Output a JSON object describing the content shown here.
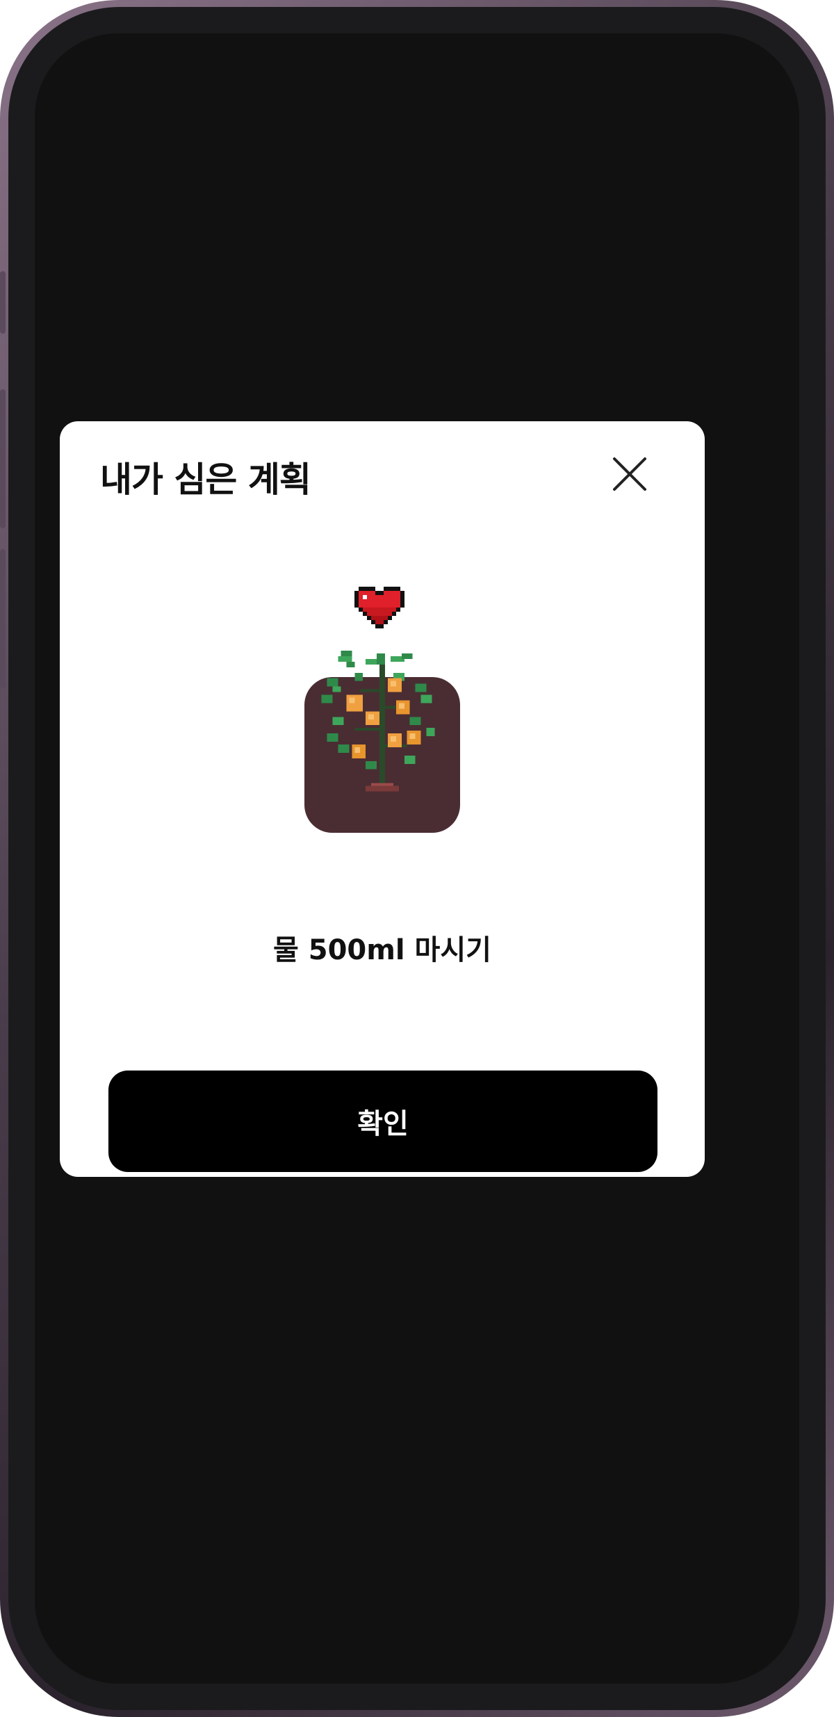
{
  "modal": {
    "title": "내가 심은 계획",
    "plan_text": "물 500ml 마시기",
    "confirm_label": "확인",
    "icons": {
      "close": "close-icon",
      "heart": "heart-icon",
      "plant": "orange-tree-icon"
    }
  },
  "colors": {
    "modal_background": "#ffffff",
    "screen_background": "#111111",
    "button_background": "#000000",
    "plant_tile": "#4a2d33",
    "heart": "#e0202a"
  }
}
